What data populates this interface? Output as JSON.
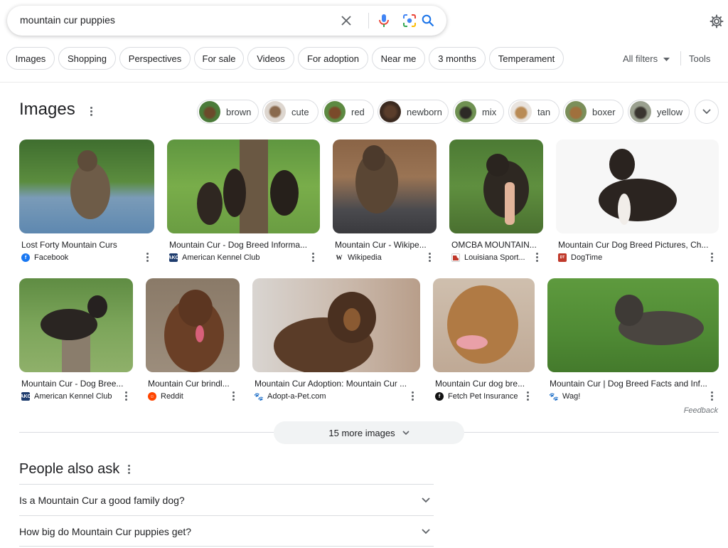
{
  "search": {
    "query": "mountain cur puppies",
    "icons": [
      "close-icon",
      "mic-icon",
      "lens-icon",
      "search-icon"
    ]
  },
  "header_icons": {
    "settings": "gear-icon"
  },
  "filters": {
    "chips": [
      "Images",
      "Shopping",
      "Perspectives",
      "For sale",
      "Videos",
      "For adoption",
      "Near me",
      "3 months",
      "Temperament"
    ],
    "all_filters": "All filters",
    "tools": "Tools"
  },
  "images_section": {
    "title": "Images",
    "related": [
      "brown",
      "cute",
      "red",
      "newborn",
      "mix",
      "tan",
      "boxer",
      "yellow"
    ],
    "results": [
      {
        "title": "Lost Forty Mountain Curs",
        "source": "Facebook",
        "source_icon": "facebook-icon"
      },
      {
        "title": "Mountain Cur - Dog Breed Informa...",
        "source": "American Kennel Club",
        "source_icon": "akc-icon"
      },
      {
        "title": "Mountain Cur - Wikipe...",
        "source": "Wikipedia",
        "source_icon": "wikipedia-icon"
      },
      {
        "title": "OMCBA MOUNTAIN...",
        "source": "Louisiana Sport...",
        "source_icon": "louisiana-icon"
      },
      {
        "title": "Mountain Cur Dog Breed Pictures, Ch...",
        "source": "DogTime",
        "source_icon": "dogtime-icon"
      },
      {
        "title": "Mountain Cur - Dog Bree...",
        "source": "American Kennel Club",
        "source_icon": "akc-icon"
      },
      {
        "title": "Mountain Cur brindl...",
        "source": "Reddit",
        "source_icon": "reddit-icon"
      },
      {
        "title": "Mountain Cur Adoption: Mountain Cur ...",
        "source": "Adopt-a-Pet.com",
        "source_icon": "paw-icon"
      },
      {
        "title": "Mountain Cur dog bre...",
        "source": "Fetch Pet Insurance",
        "source_icon": "fetch-icon"
      },
      {
        "title": "Mountain Cur | Dog Breed Facts and Inf...",
        "source": "Wag!",
        "source_icon": "wag-icon"
      }
    ],
    "feedback": "Feedback",
    "more_images": "15 more images"
  },
  "people_also_ask": {
    "title": "People also ask",
    "questions": [
      "Is a Mountain Cur a good family dog?",
      "How big do Mountain Cur puppies get?"
    ]
  },
  "colors": {
    "accent_blue": "#1a73e8",
    "chip_border": "#dadce0",
    "mic_red": "#ea4335"
  }
}
